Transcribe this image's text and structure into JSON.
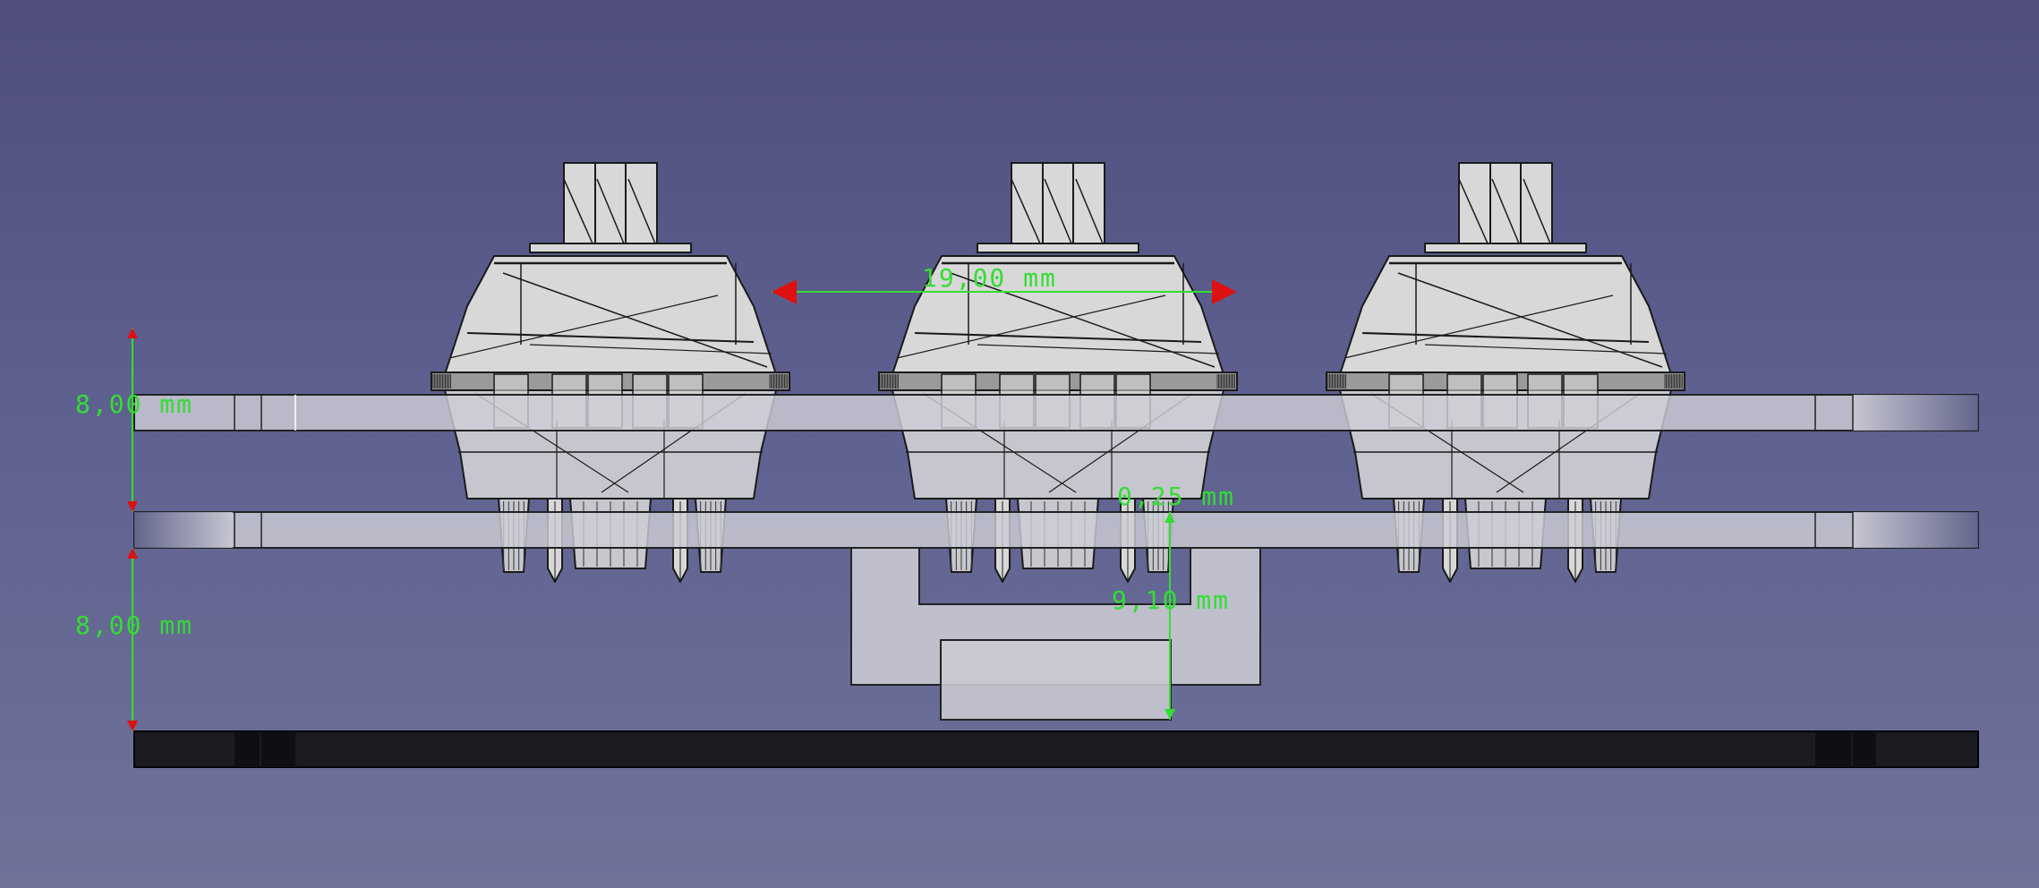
{
  "viewport": {
    "background_top": "#4f4e7d",
    "background_bottom": "#6f7299"
  },
  "dimensions": {
    "spacing_label": "19,00 mm",
    "upper_gap_label": "8,00 mm",
    "lower_gap_label": "8,00 mm",
    "small_gap_label": "0,25 mm",
    "depth_label": "9,10 mm"
  },
  "colors": {
    "dimension": "#33dd33",
    "arrow_red": "#dd1111",
    "plate_light": "#c8c8d2",
    "pcb_dark": "#1b1b22",
    "switch_fill": "#d8d8d8",
    "switch_stroke": "#1a1a1a"
  },
  "parts": {
    "switch_count": 3
  }
}
